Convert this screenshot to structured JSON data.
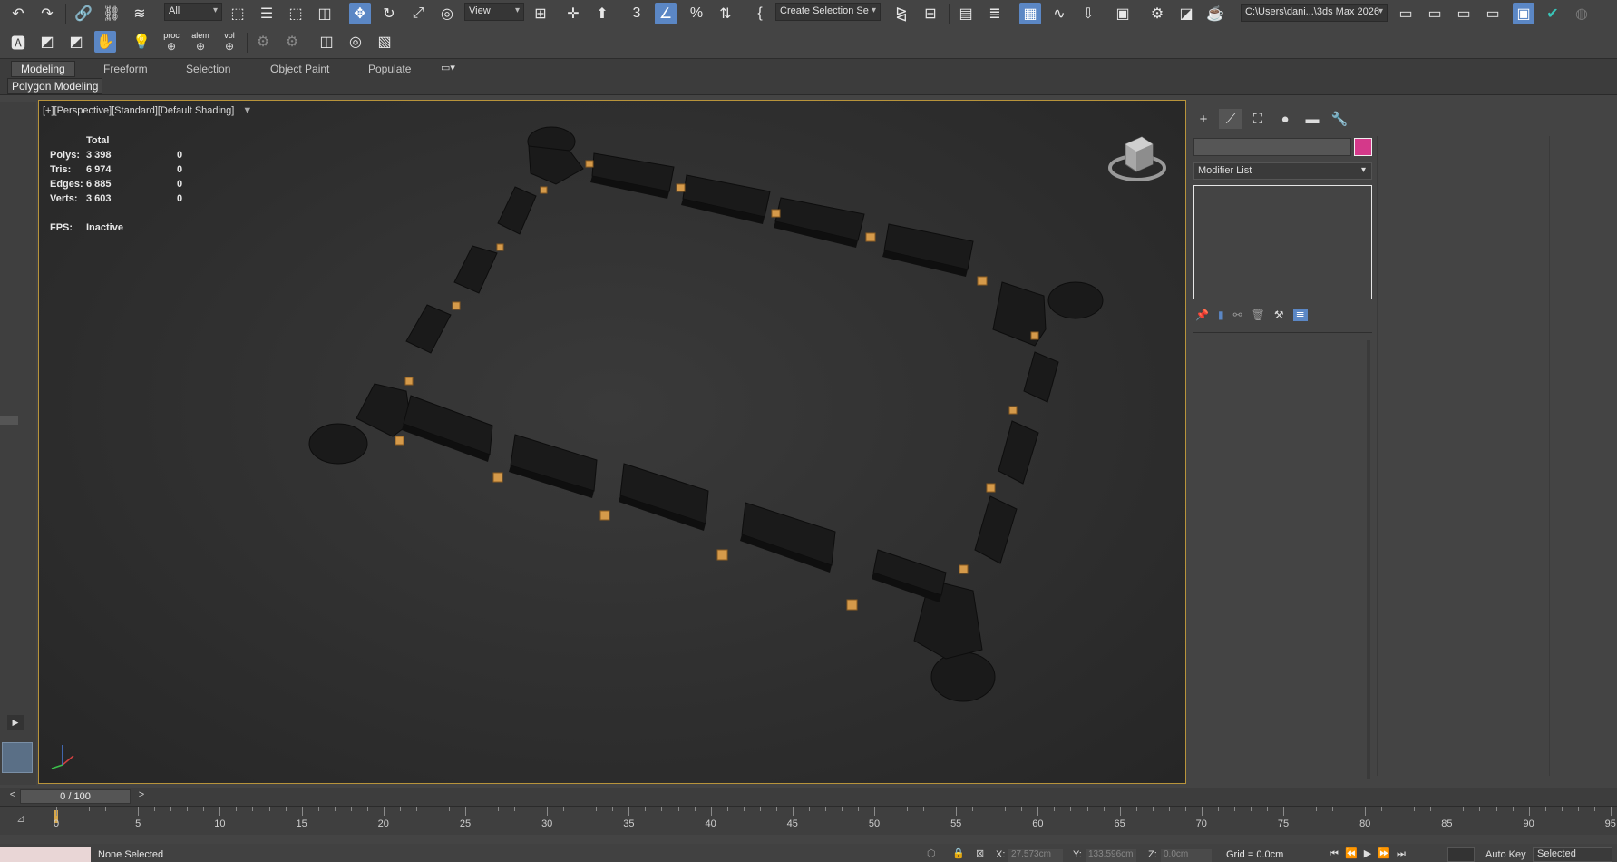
{
  "main_toolbar": {
    "selection_filter": "All",
    "ref_coord": "View",
    "named_selection": "Create Selection Se",
    "project_path": "C:\\Users\\dani...\\3ds Max 2026"
  },
  "second_toolbar": {
    "labels": [
      "proc",
      "alem",
      "vol"
    ]
  },
  "ribbon": {
    "tabs": [
      "Modeling",
      "Freeform",
      "Selection",
      "Object Paint",
      "Populate"
    ],
    "panel_label": "Polygon Modeling"
  },
  "viewport": {
    "label": "[+][Perspective][Standard][Default Shading]",
    "stats": {
      "header": "Total",
      "rows": [
        {
          "label": "Polys:",
          "total": "3 398",
          "selected": "0"
        },
        {
          "label": "Tris:",
          "total": "6 974",
          "selected": "0"
        },
        {
          "label": "Edges:",
          "total": "6 885",
          "selected": "0"
        },
        {
          "label": "Verts:",
          "total": "3 603",
          "selected": "0"
        }
      ],
      "fps_label": "FPS:",
      "fps_value": "Inactive"
    }
  },
  "command_panel": {
    "modifier_list": "Modifier List",
    "object_color": "#d4398a"
  },
  "time_slider": {
    "frame_display": "0 / 100",
    "ticks": [
      "0",
      "5",
      "10",
      "15",
      "20",
      "25",
      "30",
      "35",
      "40",
      "45",
      "50",
      "55",
      "60",
      "65",
      "70",
      "75",
      "80",
      "85",
      "90",
      "95"
    ]
  },
  "status_bar": {
    "selection": "None Selected",
    "x_label": "X:",
    "x_value": "27.573cm",
    "y_label": "Y:",
    "y_value": "133.596cm",
    "z_label": "Z:",
    "z_value": "0.0cm",
    "grid": "Grid = 0.0cm",
    "auto_key": "Auto Key",
    "key_filter": "Selected"
  },
  "colors": {
    "accent_blue": "#5b87c5",
    "viewport_border": "#b8943b",
    "piece_dark": "#1c1c1c",
    "connector_orange": "#d59a4a"
  }
}
